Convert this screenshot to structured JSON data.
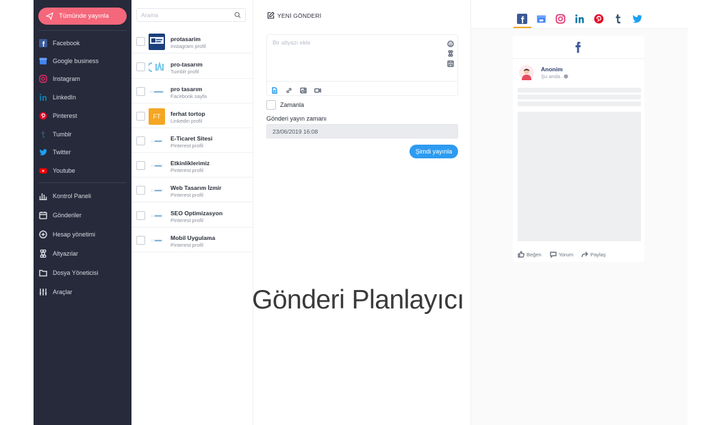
{
  "sidebar": {
    "publish_all_label": "Tümünde yayınla",
    "networks": [
      {
        "label": "Facebook",
        "icon": "facebook-icon",
        "color": "#3b5998"
      },
      {
        "label": "Google business",
        "icon": "google-business-icon",
        "color": "#4285f4"
      },
      {
        "label": "Instagram",
        "icon": "instagram-icon",
        "color": "#e1306c"
      },
      {
        "label": "LinkedIn",
        "icon": "linkedin-icon",
        "color": "#0e76a8"
      },
      {
        "label": "Pinterest",
        "icon": "pinterest-icon",
        "color": "#e60023"
      },
      {
        "label": "Tumblr",
        "icon": "tumblr-icon",
        "color": "#34526f"
      },
      {
        "label": "Twitter",
        "icon": "twitter-icon",
        "color": "#1da1f2"
      },
      {
        "label": "Youtube",
        "icon": "youtube-icon",
        "color": "#ff0000"
      }
    ],
    "tools": [
      {
        "label": "Kontrol Paneli",
        "icon": "bar-chart-icon"
      },
      {
        "label": "Gönderiler",
        "icon": "calendar-icon"
      },
      {
        "label": "Hesap yönetimi",
        "icon": "plus-circle-icon"
      },
      {
        "label": "Altyazılar",
        "icon": "command-icon"
      },
      {
        "label": "Dosya Yöneticisi",
        "icon": "folder-icon"
      },
      {
        "label": "Araçlar",
        "icon": "sliders-icon"
      }
    ]
  },
  "accounts": {
    "search_placeholder": "Arama",
    "items": [
      {
        "name": "protasarim",
        "type": "Instagram profil",
        "avatar": "logo"
      },
      {
        "name": "pro-tasarım",
        "type": "Tumblr profil",
        "avatar": "logo"
      },
      {
        "name": "pro tasarım",
        "type": "Facebook sayfa",
        "avatar": "logo"
      },
      {
        "name": "ferhat tortop",
        "type": "Linkedin profil",
        "avatar": "FT"
      },
      {
        "name": "E-Ticaret Sitesi",
        "type": "Pinterest profil",
        "avatar": "logo"
      },
      {
        "name": "Etkinliklerimiz",
        "type": "Pinterest profil",
        "avatar": "logo"
      },
      {
        "name": "Web Tasarım İzmir",
        "type": "Pinterest profil",
        "avatar": "logo"
      },
      {
        "name": "SEO Optimizasyon",
        "type": "Pinterest profil",
        "avatar": "logo"
      },
      {
        "name": "Mobil Uygulama",
        "type": "Pinterest profil",
        "avatar": "logo"
      }
    ]
  },
  "composer": {
    "title": "YENİ GÖNDERİ",
    "caption_placeholder": "Bir altyazı ekle",
    "schedule_label": "Zamanla",
    "time_label": "Gönderi yayın zamanı",
    "time_value": "23/06/2019 16:08",
    "publish_now_label": "Şimdi yayınla"
  },
  "watermark": "Gönderi Planlayıcı",
  "preview": {
    "tabs": [
      "facebook-icon",
      "google-business-icon",
      "instagram-icon",
      "linkedin-icon",
      "pinterest-icon",
      "tumblr-icon",
      "twitter-icon"
    ],
    "active_tab": "facebook-icon",
    "author": "Anonim",
    "time": "Şu anda.",
    "actions": [
      "Beğen",
      "Yorum",
      "Paylaş"
    ]
  },
  "colors": {
    "sidebar_bg": "#262a3a",
    "accent_pink": "#f5677a",
    "accent_blue": "#2d9bf0",
    "tab_underline": "#f5a623"
  }
}
